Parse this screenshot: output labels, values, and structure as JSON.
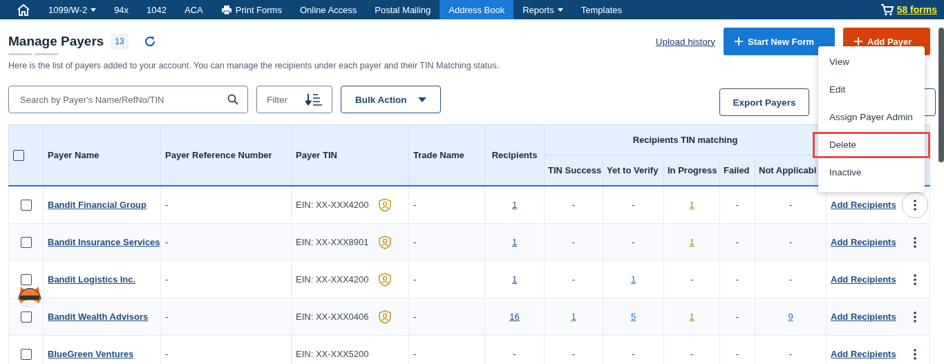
{
  "nav": {
    "items": [
      {
        "label": "1099/W-2",
        "kind": "plain",
        "dropdown": true,
        "selected": false
      },
      {
        "label": "94x",
        "kind": "plain",
        "dropdown": false,
        "selected": false
      },
      {
        "label": "1042",
        "kind": "plain",
        "dropdown": false,
        "selected": false
      },
      {
        "label": "ACA",
        "kind": "plain",
        "dropdown": false,
        "selected": false
      },
      {
        "label": "Print Forms",
        "kind": "print",
        "dropdown": false,
        "selected": false
      },
      {
        "label": "Online Access",
        "kind": "plain",
        "dropdown": false,
        "selected": false
      },
      {
        "label": "Postal Mailing",
        "kind": "plain",
        "dropdown": false,
        "selected": false
      },
      {
        "label": "Address Book",
        "kind": "plain",
        "dropdown": false,
        "selected": true
      },
      {
        "label": "Reports",
        "kind": "plain",
        "dropdown": true,
        "selected": false
      },
      {
        "label": "Templates",
        "kind": "plain",
        "dropdown": false,
        "selected": false
      }
    ],
    "cart": "58 forms"
  },
  "header": {
    "title": "Manage Payers",
    "count": "13",
    "description": "Here is the list of payers added to your account. You can manage the recipients under each payer and their TIN Matching status.",
    "upload_link": "Upload history",
    "start_button": "Start New Form",
    "add_button": "Add Payer"
  },
  "toolbar": {
    "search_placeholder": "Search by Payer's Name/RefNo/TIN",
    "filter": "Filter",
    "bulk_action": "Bulk Action",
    "export_button": "Export Payers"
  },
  "table": {
    "columns": [
      "Payer Name",
      "Payer Reference Number",
      "Payer TIN",
      "Trade Name",
      "Recipients"
    ],
    "group_header": "Recipients TIN matching",
    "sub_columns": [
      "TIN Success",
      "Yet to Verify",
      "In Progress",
      "Failed",
      "Not Applicabl"
    ],
    "all_checked": false,
    "rows": [
      {
        "checked": false,
        "name": "Bandit Financial Group",
        "ref": "-",
        "tin": "EIN: XX-XXX4200",
        "verified": true,
        "trade": "-",
        "recipients": {
          "text": "1",
          "linked": true
        },
        "counts": [
          {
            "text": "-",
            "linked": false
          },
          {
            "text": "-",
            "linked": false
          },
          {
            "text": "1",
            "linked": true
          },
          {
            "text": "-",
            "linked": false
          },
          {
            "text": "-",
            "linked": false
          }
        ],
        "action": "Add Recipients",
        "menu_open": true
      },
      {
        "checked": false,
        "name": "Bandit Insurance Services",
        "ref": "-",
        "tin": "EIN: XX-XXX8901",
        "verified": true,
        "trade": "-",
        "recipients": {
          "text": "1",
          "linked": true
        },
        "counts": [
          {
            "text": "-",
            "linked": false
          },
          {
            "text": "-",
            "linked": false
          },
          {
            "text": "1",
            "linked": true
          },
          {
            "text": "-",
            "linked": false
          },
          {
            "text": "-",
            "linked": false
          }
        ],
        "action": "Add Recipients",
        "menu_open": false
      },
      {
        "checked": false,
        "name": "Bandit Logistics Inc.",
        "ref": "-",
        "tin": "EIN: XX-XXX4200",
        "verified": true,
        "trade": "-",
        "recipients": {
          "text": "1",
          "linked": true
        },
        "counts": [
          {
            "text": "-",
            "linked": false
          },
          {
            "text": "1",
            "linked": true
          },
          {
            "text": "-",
            "linked": false
          },
          {
            "text": "-",
            "linked": false
          },
          {
            "text": "-",
            "linked": false
          }
        ],
        "action": "Add Recipients",
        "menu_open": false
      },
      {
        "checked": false,
        "name": "Bandit Wealth Advisors",
        "ref": "-",
        "tin": "EIN: XX-XXX0406",
        "verified": true,
        "trade": "-",
        "recipients": {
          "text": "16",
          "linked": true
        },
        "counts": [
          {
            "text": "1",
            "linked": true
          },
          {
            "text": "5",
            "linked": true
          },
          {
            "text": "1",
            "linked": true
          },
          {
            "text": "-",
            "linked": false
          },
          {
            "text": "9",
            "linked": true
          }
        ],
        "action": "Add Recipients",
        "menu_open": false
      },
      {
        "checked": false,
        "name": "BlueGreen Ventures",
        "ref": "-",
        "tin": "EIN: XX-XXX5200",
        "verified": false,
        "trade": "-",
        "recipients": {
          "text": "-",
          "linked": false
        },
        "counts": [
          {
            "text": "-",
            "linked": false
          },
          {
            "text": "-",
            "linked": false
          },
          {
            "text": "-",
            "linked": false
          },
          {
            "text": "-",
            "linked": false
          },
          {
            "text": "-",
            "linked": false
          }
        ],
        "action": "Add Recipients",
        "menu_open": false
      }
    ]
  },
  "row_menu": {
    "items": [
      {
        "label": "View",
        "highlighted": false
      },
      {
        "label": "Edit",
        "highlighted": false
      },
      {
        "label": "Assign Payer Admin",
        "highlighted": false
      },
      {
        "label": "Delete",
        "highlighted": true
      },
      {
        "label": "Inactive",
        "highlighted": false
      }
    ]
  }
}
